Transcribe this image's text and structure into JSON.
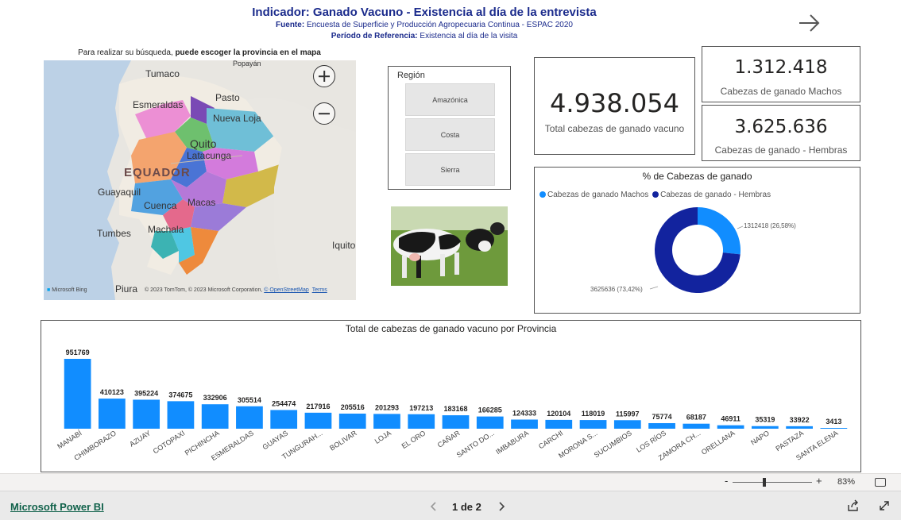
{
  "header": {
    "title": "Indicador: Ganado Vacuno - Existencia al día de la entrevista",
    "fuente_label": "Fuente:",
    "fuente_value": "Encuesta de Superficie y Producción Agropecuaria Continua - ESPAC 2020",
    "periodo_label": "Período de Referencia:",
    "periodo_value": "Existencia al día de la visita",
    "next_icon": "arrow-right-icon"
  },
  "map": {
    "hint_prefix": "Para realizar su búsqueda, ",
    "hint_bold": "puede escoger la provincia en el mapa",
    "labels": {
      "tumaco": "Tumaco",
      "popayan": "Popayán",
      "esmeraldas": "Esmeraldas",
      "pasto": "Pasto",
      "nueva_loja": "Nueva Loja",
      "quito": "Quito",
      "latacunga": "Latacunga",
      "ecuador": "EQUADOR",
      "guayaquil": "Guayaquil",
      "cuenca": "Cuenca",
      "macas": "Macas",
      "machala": "Machala",
      "tumbes": "Tumbes",
      "iquitos": "Iquito",
      "piura": "Piura"
    },
    "bing": "Microsoft Bing",
    "attribution": "© 2023 TomTom, © 2023 Microsoft Corporation, ",
    "osm": "© OpenStreetMap",
    "terms": "Terms"
  },
  "slicer": {
    "title": "Región",
    "items": [
      "Amazónica",
      "Costa",
      "Sierra"
    ]
  },
  "cards": {
    "total_value": "4.938.054",
    "total_label": "Total cabezas de ganado vacuno",
    "machos_value": "1.312.418",
    "machos_label": "Cabezas de ganado Machos",
    "hembras_value": "3.625.636",
    "hembras_label": "Cabezas de ganado - Hembras"
  },
  "chart_data": [
    {
      "type": "pie",
      "title": "% de Cabezas de ganado",
      "legend_position": "top-left",
      "series": [
        {
          "name": "Cabezas de ganado Machos",
          "value": 1312418,
          "label": "1312418 (26,58%)",
          "color": "#118dff"
        },
        {
          "name": "Cabezas de ganado - Hembras",
          "value": 3625636,
          "label": "3625636 (73,42%)",
          "color": "#12239e"
        }
      ]
    },
    {
      "type": "bar",
      "title": "Total de cabezas de ganado vacuno por Provincia",
      "color": "#118dff",
      "categories": [
        "MANABÍ",
        "CHIMBORAZO",
        "AZUAY",
        "COTOPAXI",
        "PICHINCHA",
        "ESMERALDAS",
        "GUAYAS",
        "TUNGURAH...",
        "BOLIVAR",
        "LOJA",
        "EL ORO",
        "CAÑAR",
        "SANTO DO...",
        "IMBABURA",
        "CARCHI",
        "MORONA S...",
        "SUCUMBIOS",
        "LOS RÍOS",
        "ZAMORA CH...",
        "ORELLANA",
        "NAPO",
        "PASTAZA",
        "SANTA ELENA"
      ],
      "values": [
        951769,
        410123,
        395224,
        374675,
        332906,
        305514,
        254474,
        217916,
        205516,
        201293,
        197213,
        183168,
        166285,
        124333,
        120104,
        118019,
        115997,
        75774,
        68187,
        46911,
        35319,
        33922,
        3413
      ],
      "ylim": [
        0,
        951769
      ],
      "grid": false
    }
  ],
  "footer": {
    "zoom_minus": "-",
    "zoom_plus": "+",
    "zoom_pct": "83%",
    "zoom_level": 0.4,
    "brand": "Microsoft Power BI",
    "pager": "1 de 2",
    "prev_icon": "chevron-left-icon",
    "next_icon": "chevron-right-icon",
    "share_icon": "share-icon",
    "expand_icon": "expand-icon",
    "fit_icon": "fit-to-page-icon"
  }
}
